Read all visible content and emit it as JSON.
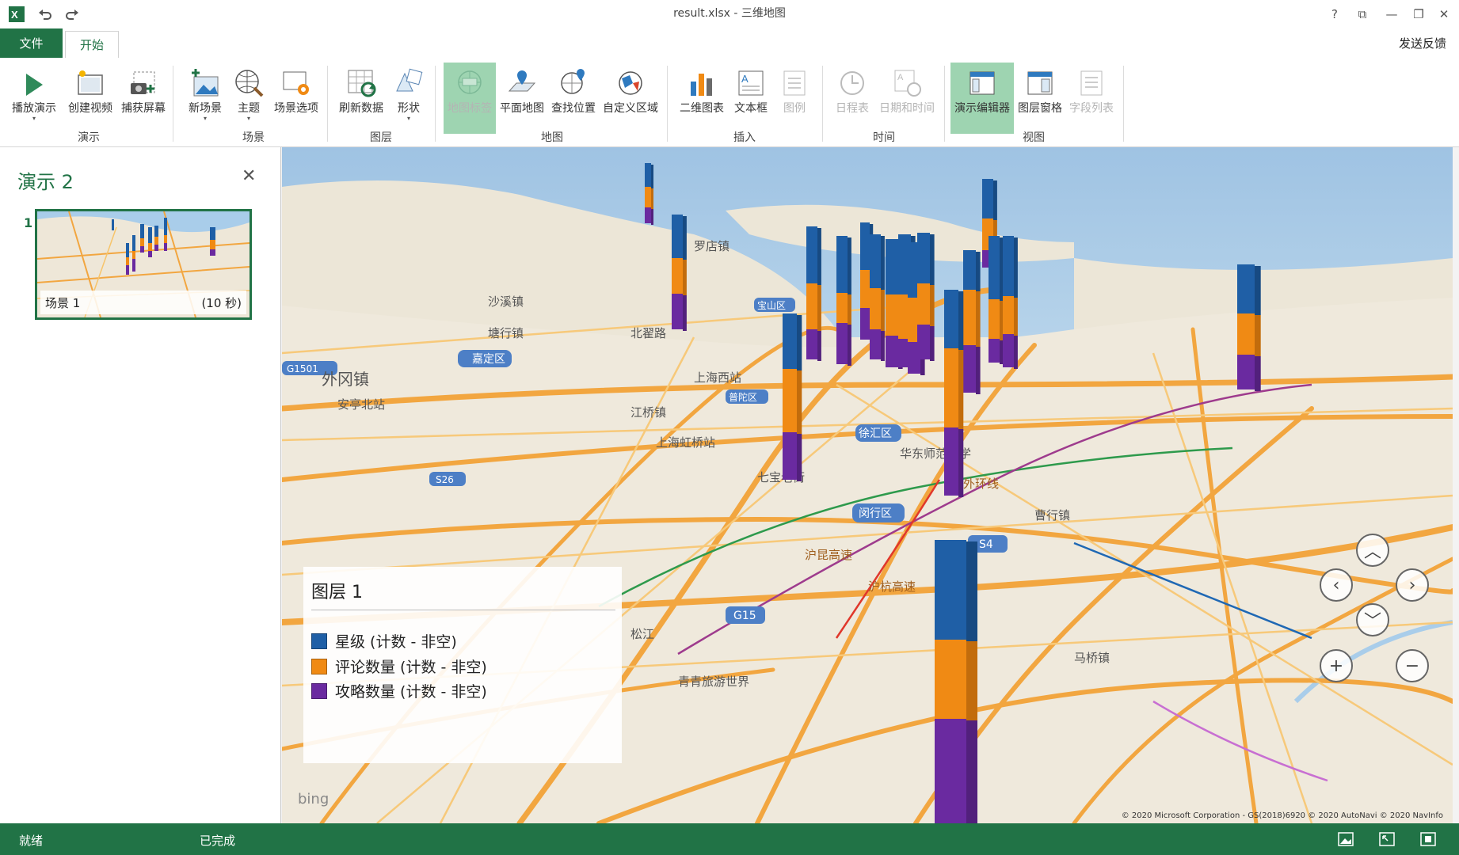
{
  "window": {
    "title": "result.xlsx - 三维地图",
    "controls": [
      "?",
      "⧉",
      "—",
      "❐",
      "✕"
    ]
  },
  "tabs": {
    "file": "文件",
    "home": "开始",
    "feedback": "发送反馈"
  },
  "ribbon": {
    "buttons": [
      {
        "label": "播放演示",
        "icon": "play-icon"
      },
      {
        "label": "创建视频",
        "icon": "video-icon"
      },
      {
        "label": "捕获屏幕",
        "icon": "camera-icon"
      },
      {
        "label": "新场景",
        "icon": "new-scene-icon"
      },
      {
        "label": "主题",
        "icon": "globe-brush-icon"
      },
      {
        "label": "场景选项",
        "icon": "scene-options-icon"
      },
      {
        "label": "刷新数据",
        "icon": "refresh-icon"
      },
      {
        "label": "形状",
        "icon": "shape-icon"
      },
      {
        "label": "地图标签",
        "icon": "map-labels-icon"
      },
      {
        "label": "平面地图",
        "icon": "flat-map-icon"
      },
      {
        "label": "查找位置",
        "icon": "find-location-icon"
      },
      {
        "label": "自定义区域",
        "icon": "custom-region-icon"
      },
      {
        "label": "二维图表",
        "icon": "bar-chart-icon"
      },
      {
        "label": "文本框",
        "icon": "textbox-icon"
      },
      {
        "label": "图例",
        "icon": "legend-icon"
      },
      {
        "label": "日程表",
        "icon": "clock-icon"
      },
      {
        "label": "日期和时间",
        "icon": "date-time-icon"
      },
      {
        "label": "演示编辑器",
        "icon": "tour-editor-icon"
      },
      {
        "label": "图层窗格",
        "icon": "layer-pane-icon"
      },
      {
        "label": "字段列表",
        "icon": "field-list-icon"
      }
    ],
    "groups": [
      "演示",
      "场景",
      "图层",
      "地图",
      "插入",
      "时间",
      "视图"
    ]
  },
  "tour": {
    "title": "演示 2",
    "scene_number": "1",
    "scene_name": "场景 1",
    "scene_duration": "(10 秒)"
  },
  "legend": {
    "title": "图层 1",
    "items": [
      {
        "label": "星级 (计数 - 非空)",
        "color": "#1f5fa6"
      },
      {
        "label": "评论数量 (计数 - 非空)",
        "color": "#f08a14"
      },
      {
        "label": "攻略数量 (计数 - 非空)",
        "color": "#6a2aa0"
      }
    ]
  },
  "map": {
    "attribution": "© 2020 Microsoft Corporation - GS(2018)6920  © 2020 AutoNavi  © 2020 NavInfo",
    "bing": "bing",
    "labels": [
      "嘉定区",
      "外冈镇",
      "安亭北站",
      "江桥镇",
      "上海虹桥站",
      "七宝老街",
      "闵行区",
      "徐汇区",
      "上海西站",
      "普陀区",
      "曹行镇",
      "马桥镇",
      "松江",
      "青青旅游世界",
      "华东师范大学",
      "宝山区",
      "北翟路",
      "G1501",
      "S4",
      "G15",
      "沪昆高速",
      "沪杭高速",
      "外环线",
      "S26",
      "塘行镇",
      "沙溪镇",
      "罗店镇"
    ]
  },
  "status": {
    "ready": "就绪",
    "done": "已完成"
  },
  "colors": {
    "accent": "#217346",
    "active": "#9ed4b1",
    "water": "#a9cdea",
    "land": "#efe9dc",
    "road": "#f2a640"
  }
}
